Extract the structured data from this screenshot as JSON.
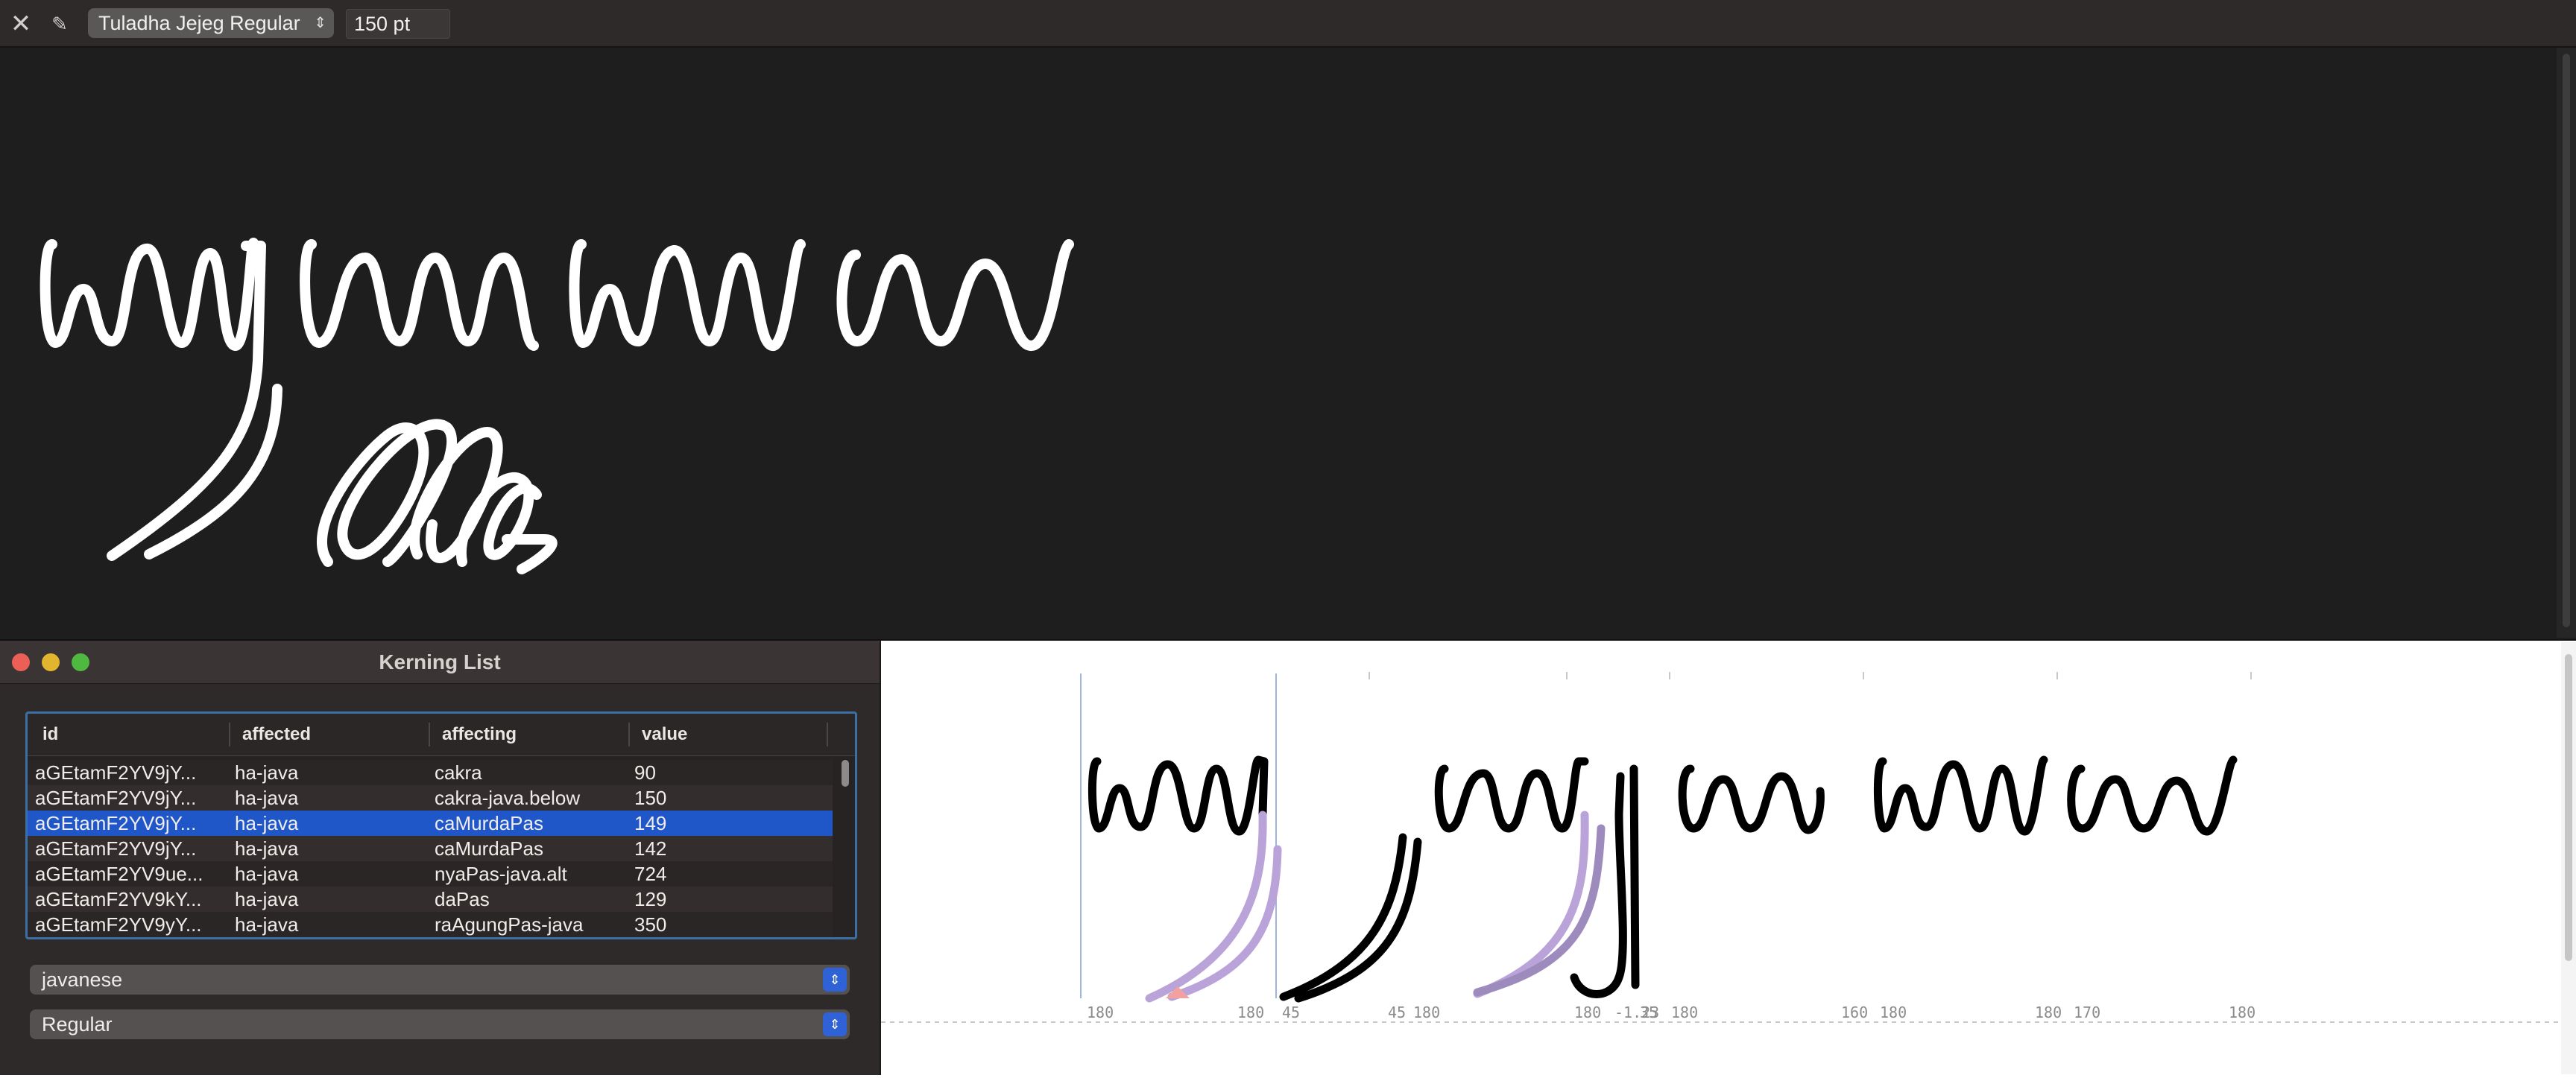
{
  "preview": {
    "font_name": "Tuladha Jejeg Regular",
    "font_size": "150 pt",
    "icons": {
      "close": "close-icon",
      "pin": "pin-icon"
    }
  },
  "kerning_list": {
    "title": "Kerning List",
    "columns": {
      "id": "id",
      "affected": "affected",
      "affecting": "affecting",
      "value": "value"
    },
    "rows": [
      {
        "id": "aGEtamF2YV9jY...",
        "affected": "ha-java",
        "affecting": "cakra",
        "value": "90",
        "selected": false
      },
      {
        "id": "aGEtamF2YV9jY...",
        "affected": "ha-java",
        "affecting": "cakra-java.below",
        "value": "150",
        "selected": false
      },
      {
        "id": "aGEtamF2YV9jY...",
        "affected": "ha-java",
        "affecting": "caMurdaPas",
        "value": "149",
        "selected": true
      },
      {
        "id": "aGEtamF2YV9jY...",
        "affected": "ha-java",
        "affecting": "caMurdaPas",
        "value": "142",
        "selected": false
      },
      {
        "id": "aGEtamF2YV9ue...",
        "affected": "ha-java",
        "affecting": "nyaPas-java.alt",
        "value": "724",
        "selected": false
      },
      {
        "id": "aGEtamF2YV9kY...",
        "affected": "ha-java",
        "affecting": "daPas",
        "value": "129",
        "selected": false
      },
      {
        "id": "aGEtamF2YV9yY...",
        "affected": "ha-java",
        "affecting": "raAgungPas-java",
        "value": "350",
        "selected": false
      }
    ],
    "script_popup": "javanese",
    "style_popup": "Regular"
  },
  "edit_view": {
    "metrics": [
      "180",
      "180",
      "45",
      "45",
      "180",
      "180",
      "-1.23",
      "35",
      "180",
      "160",
      "180",
      "180",
      "170",
      "180"
    ]
  },
  "colors": {
    "accent": "#1f57c9",
    "preview_bg": "#1e1e1e",
    "kern_highlight": "#b9a3d8",
    "kern_marker": "#f2a0a0"
  }
}
